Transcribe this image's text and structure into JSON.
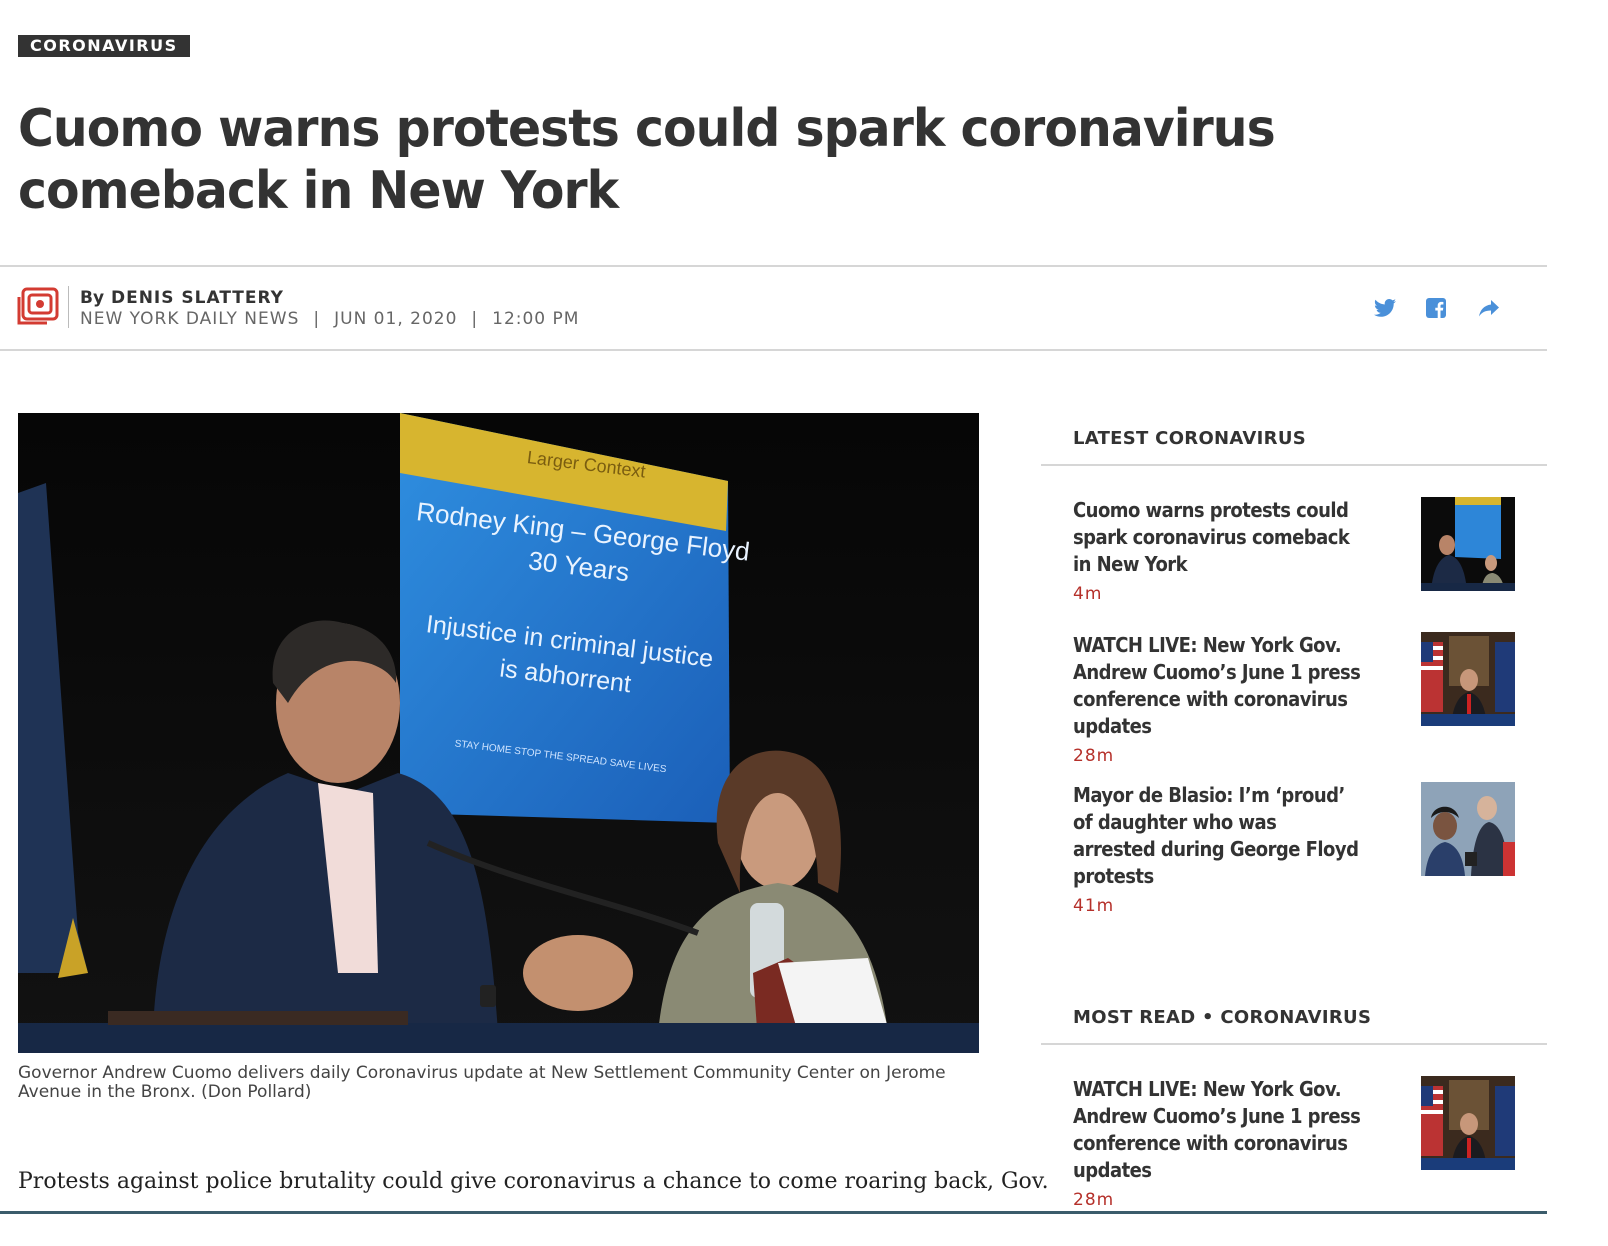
{
  "article": {
    "kicker": "CORONAVIRUS",
    "headline": "Cuomo warns protests could spark coronavirus comeback in New York",
    "byline": {
      "prefix": "By",
      "author": "DENIS SLATTERY",
      "publication": "NEW YORK DAILY NEWS",
      "separator": "|",
      "date": "JUN 01, 2020",
      "time": "12:00 PM"
    },
    "share_icons": [
      "twitter-icon",
      "facebook-icon",
      "share-forward-icon"
    ],
    "photo": {
      "screen": {
        "banner": "Larger Context",
        "line1": "Rodney King – George Floyd",
        "line2": "30 Years",
        "line3": "Injustice in criminal justice",
        "line4": "is abhorrent",
        "footer": "STAY HOME   STOP THE SPREAD   SAVE LIVES"
      }
    },
    "caption": "Governor Andrew Cuomo delivers daily Coronavirus update at New Settlement Community Center on Jerome Avenue in the Bronx. (Don Pollard)",
    "body_first_line": "Protests against police brutality could give coronavirus a chance to come roaring back, Gov."
  },
  "sidebar": {
    "latest": {
      "title": "LATEST CORONAVIRUS",
      "items": [
        {
          "title": "Cuomo warns protests could spark coronavirus comeback in New York",
          "time": "4m"
        },
        {
          "title": "WATCH LIVE: New York Gov. Andrew Cuomo’s June 1 press conference with coronavirus updates",
          "time": "28m"
        },
        {
          "title": "Mayor de Blasio: I’m ‘proud’ of daughter who was arrested during George Floyd protests",
          "time": "41m"
        }
      ]
    },
    "most_read": {
      "title": "MOST READ • CORONAVIRUS",
      "items": [
        {
          "title": "WATCH LIVE: New York Gov. Andrew Cuomo’s June 1 press conference with coronavirus updates",
          "time": "28m"
        }
      ]
    }
  },
  "colors": {
    "headline": "#333333",
    "time_accent": "#b5302a",
    "share_icon": "#4a90d9",
    "logo_red": "#d33b32"
  }
}
